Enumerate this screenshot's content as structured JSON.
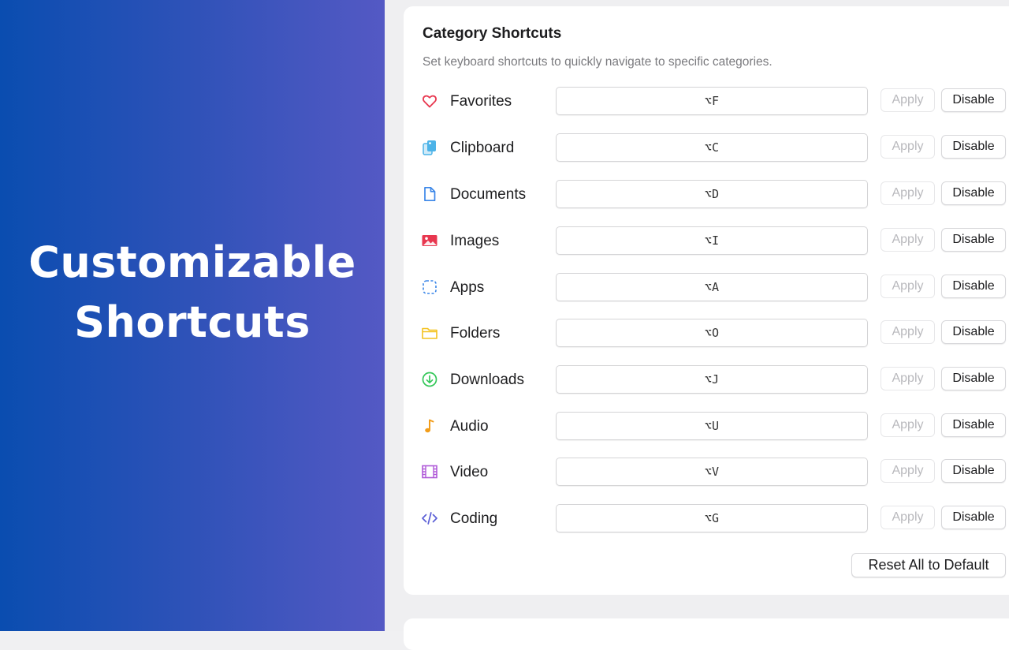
{
  "hero": {
    "line1": "Customizable",
    "line2": "Shortcuts"
  },
  "section": {
    "title": "Category Shortcuts",
    "subtitle": "Set keyboard shortcuts to quickly navigate to specific categories.",
    "apply_label": "Apply",
    "disable_label": "Disable",
    "reset_label": "Reset All to Default",
    "categories": [
      {
        "label": "Favorites",
        "shortcut": "⌥F",
        "icon": "heart-icon",
        "color": "#e8374f"
      },
      {
        "label": "Clipboard",
        "shortcut": "⌥C",
        "icon": "clipboard-icon",
        "color": "#4cb3e8"
      },
      {
        "label": "Documents",
        "shortcut": "⌥D",
        "icon": "document-icon",
        "color": "#3a86e8"
      },
      {
        "label": "Images",
        "shortcut": "⌥I",
        "icon": "image-icon",
        "color": "#e8374f"
      },
      {
        "label": "Apps",
        "shortcut": "⌥A",
        "icon": "apps-icon",
        "color": "#3a86e8"
      },
      {
        "label": "Folders",
        "shortcut": "⌥O",
        "icon": "folder-icon",
        "color": "#f4c21e"
      },
      {
        "label": "Downloads",
        "shortcut": "⌥J",
        "icon": "download-icon",
        "color": "#34c759"
      },
      {
        "label": "Audio",
        "shortcut": "⌥U",
        "icon": "music-note-icon",
        "color": "#f29d1a"
      },
      {
        "label": "Video",
        "shortcut": "⌥V",
        "icon": "film-icon",
        "color": "#b05ad8"
      },
      {
        "label": "Coding",
        "shortcut": "⌥G",
        "icon": "code-icon",
        "color": "#5b5fd6"
      }
    ]
  }
}
